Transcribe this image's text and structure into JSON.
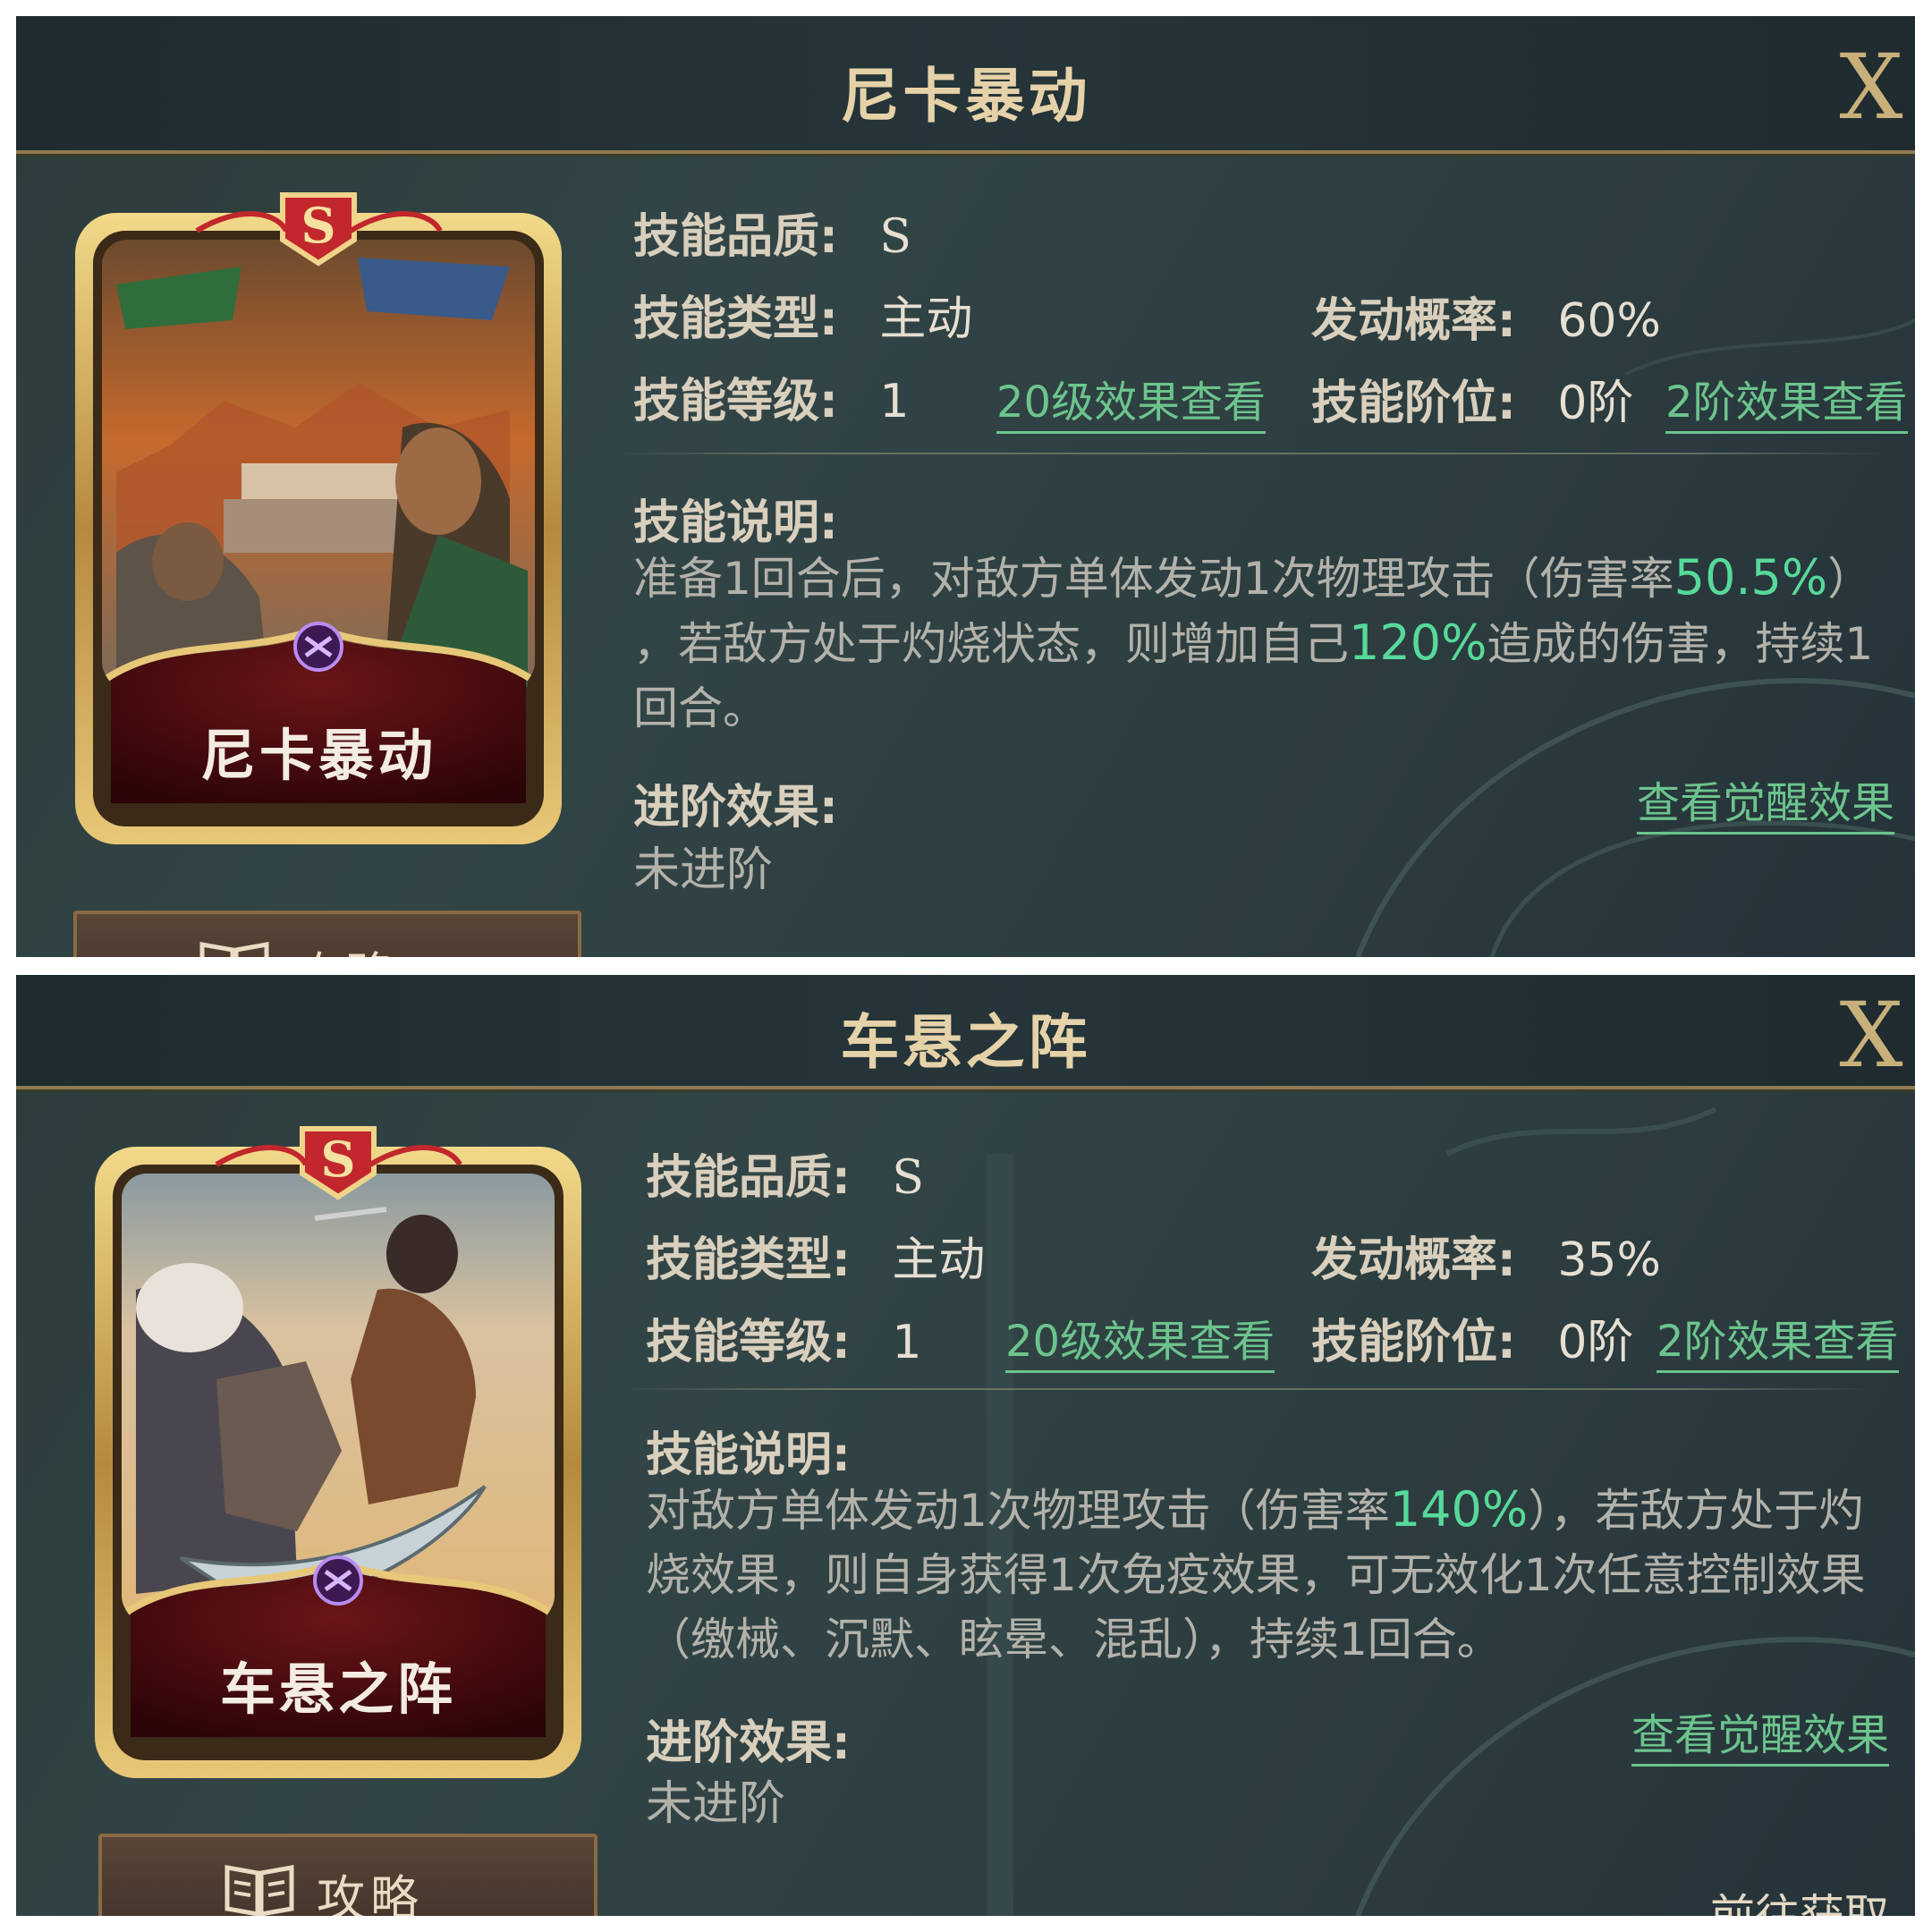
{
  "panels": [
    {
      "title": "尼卡暴动",
      "close_label": "X",
      "card": {
        "name": "尼卡暴动",
        "grade": "S"
      },
      "strategy_label": "攻略",
      "quality_label": "技能品质:",
      "quality_value": "S",
      "type_label": "技能类型:",
      "type_value": "主动",
      "rate_label": "发动概率:",
      "rate_value": "60%",
      "level_label": "技能等级:",
      "level_value": "1",
      "level_link": "20级效果查看",
      "rank_label": "技能阶位:",
      "rank_value": "0阶",
      "rank_link": "2阶效果查看",
      "desc_label": "技能说明:",
      "desc": [
        {
          "t": "准备1回合后，对敌方单体发动1次物理攻击（伤害率"
        },
        {
          "t": "50.5%",
          "hl": true
        },
        {
          "t": "）"
        },
        {
          "t": "，若敌方处于灼烧状态，则增加自己"
        },
        {
          "t": "120%",
          "hl": true
        },
        {
          "t": "造成的伤害，持续1回合。"
        }
      ],
      "adv_label": "进阶效果:",
      "adv_link": "查看觉醒效果",
      "adv_value": "未进阶"
    },
    {
      "title": "车悬之阵",
      "close_label": "X",
      "card": {
        "name": "车悬之阵",
        "grade": "S"
      },
      "strategy_label": "攻略",
      "quality_label": "技能品质:",
      "quality_value": "S",
      "type_label": "技能类型:",
      "type_value": "主动",
      "rate_label": "发动概率:",
      "rate_value": "35%",
      "level_label": "技能等级:",
      "level_value": "1",
      "level_link": "20级效果查看",
      "rank_label": "技能阶位:",
      "rank_value": "0阶",
      "rank_link": "2阶效果查看",
      "desc_label": "技能说明:",
      "desc": [
        {
          "t": "对敌方单体发动1次物理攻击（伤害率"
        },
        {
          "t": "140%",
          "hl": true
        },
        {
          "t": "），若敌方处于灼烧效果，则自身获得1次免疫效果，可无效化1次任意控制效果（缴械、沉默、眩晕、混乱），持续1回合。"
        }
      ],
      "adv_label": "进阶效果:",
      "adv_link": "查看觉醒效果",
      "adv_value": "未进阶",
      "goto_label": "前往获取"
    }
  ],
  "colors": {
    "accent_green": "#57d99a",
    "gold": "#c9b07a",
    "card_red": "#5a0f12"
  },
  "icons": [
    "close-icon",
    "book-icon",
    "grade-s-badge",
    "faction-icon"
  ]
}
